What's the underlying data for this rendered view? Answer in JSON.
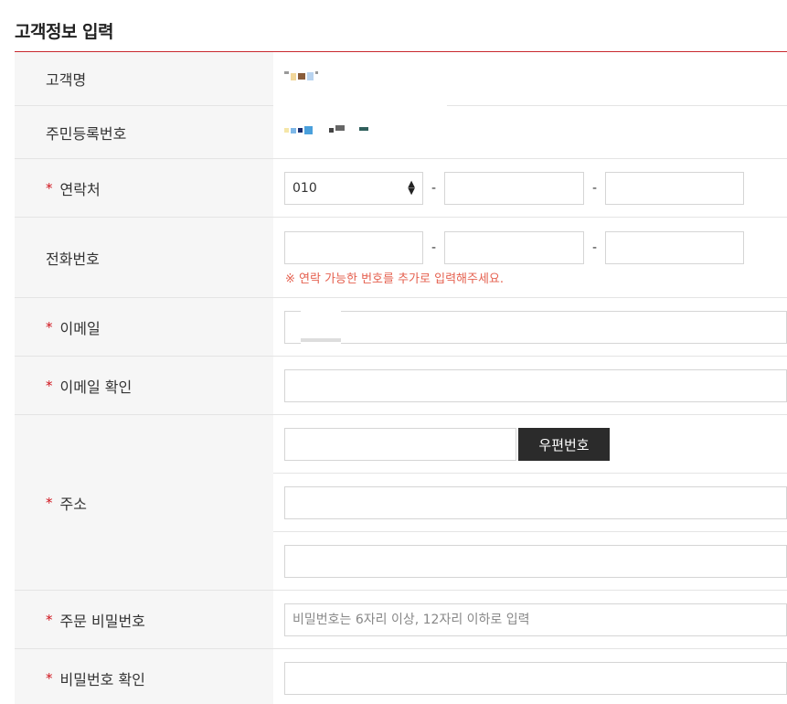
{
  "section": {
    "title": "고객정보 입력"
  },
  "fields": {
    "name": {
      "label": "고객명",
      "value_masked": true
    },
    "ssn": {
      "label": "주민등록번호",
      "value_masked": true
    },
    "contact": {
      "label": "연락처",
      "required_mark": "*",
      "prefix_value": "010",
      "dash": "-",
      "part2_value": "",
      "part3_value": ""
    },
    "phone": {
      "label": "전화번호",
      "dash": "-",
      "notice": "※ 연락 가능한 번호를 추가로 입력해주세요."
    },
    "email": {
      "label": "이메일",
      "required_mark": "*"
    },
    "email_confirm": {
      "label": "이메일 확인",
      "required_mark": "*"
    },
    "address": {
      "label": "주소",
      "required_mark": "*",
      "zip_button": "우편번호"
    },
    "order_password": {
      "label": "주문 비밀번호",
      "required_mark": "*",
      "placeholder": "비밀번호는 6자리 이상, 12자리 이하로 입력"
    },
    "password_confirm": {
      "label": "비밀번호 확인",
      "required_mark": "*"
    }
  },
  "colors": {
    "accent": "#c8282e",
    "required": "#d0121b",
    "notice": "#e5604f",
    "button_bg": "#2b2b2b"
  }
}
